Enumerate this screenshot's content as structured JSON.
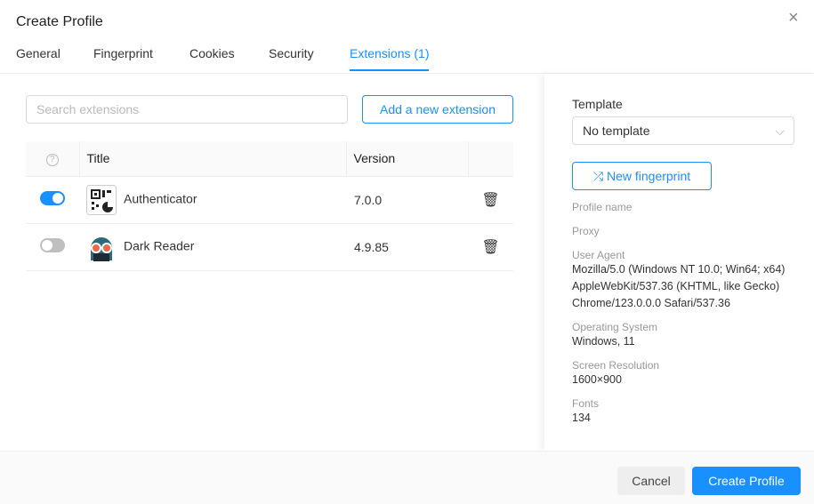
{
  "dialog": {
    "title": "Create Profile",
    "close": "×"
  },
  "tabs": [
    {
      "label": "General"
    },
    {
      "label": "Fingerprint"
    },
    {
      "label": "Cookies"
    },
    {
      "label": "Security"
    },
    {
      "label": "Extensions (1)",
      "active": true
    }
  ],
  "extensions": {
    "search_placeholder": "Search extensions",
    "add_label": "Add a new extension",
    "columns": {
      "help": "?",
      "title": "Title",
      "version": "Version"
    },
    "rows": [
      {
        "enabled": true,
        "icon": "qr-code-icon",
        "title": "Authenticator",
        "version": "7.0.0"
      },
      {
        "enabled": false,
        "icon": "dark-reader-icon",
        "title": "Dark Reader",
        "version": "4.9.85"
      }
    ]
  },
  "sidebar": {
    "template_label": "Template",
    "template_value": "No template",
    "new_fingerprint": "New fingerprint",
    "fields": [
      {
        "label": "Profile name",
        "value": ""
      },
      {
        "label": "Proxy",
        "value": ""
      },
      {
        "label": "User Agent",
        "value": "Mozilla/5.0 (Windows NT 10.0; Win64; x64) AppleWebKit/537.36 (KHTML, like Gecko) Chrome/123.0.0.0 Safari/537.36"
      },
      {
        "label": "Operating System",
        "value": "Windows, 11"
      },
      {
        "label": "Screen Resolution",
        "value": "1600×900"
      },
      {
        "label": "Fonts",
        "value": "134"
      }
    ]
  },
  "footer": {
    "cancel": "Cancel",
    "create": "Create Profile"
  },
  "colors": {
    "accent": "#1890ff"
  }
}
